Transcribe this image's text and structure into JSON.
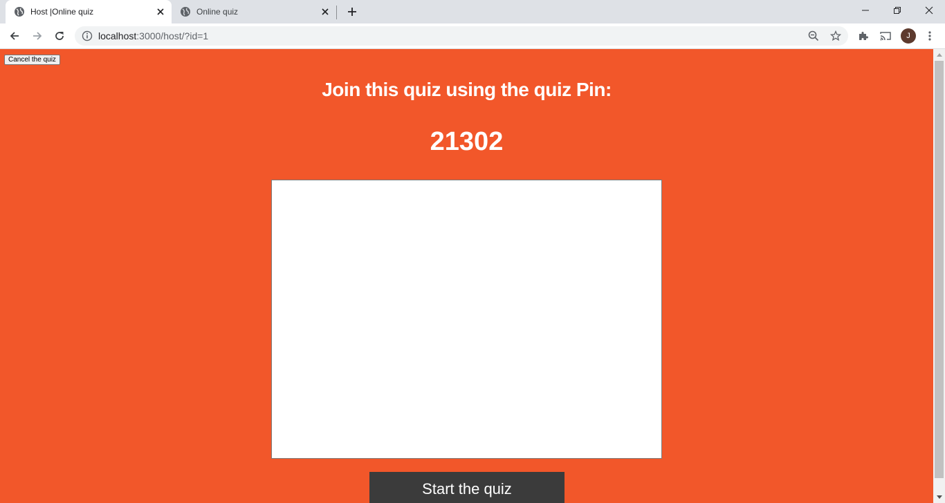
{
  "browser": {
    "tabs": [
      {
        "title": "Host |Online quiz",
        "active": true
      },
      {
        "title": "Online quiz",
        "active": false
      }
    ],
    "address": {
      "host": "localhost",
      "path": ":3000/host/?id=1"
    },
    "profile_initial": "J",
    "icons": {
      "tab_favicon": "globe-icon",
      "back": "arrow-left-icon",
      "forward": "arrow-right-icon",
      "reload": "reload-icon",
      "site_info": "info-icon",
      "zoom": "zoom-out-icon",
      "bookmark": "star-icon",
      "extensions": "puzzle-icon",
      "cast": "cast-icon",
      "menu": "kebab-menu-icon"
    }
  },
  "page": {
    "cancel_label": "Cancel the quiz",
    "join_title": "Join this quiz using the quiz Pin:",
    "pin": "21302",
    "start_label": "Start the quiz",
    "colors": {
      "background": "#f2572a",
      "start_button": "#3b3b3b",
      "players_box": "#ffffff"
    }
  }
}
